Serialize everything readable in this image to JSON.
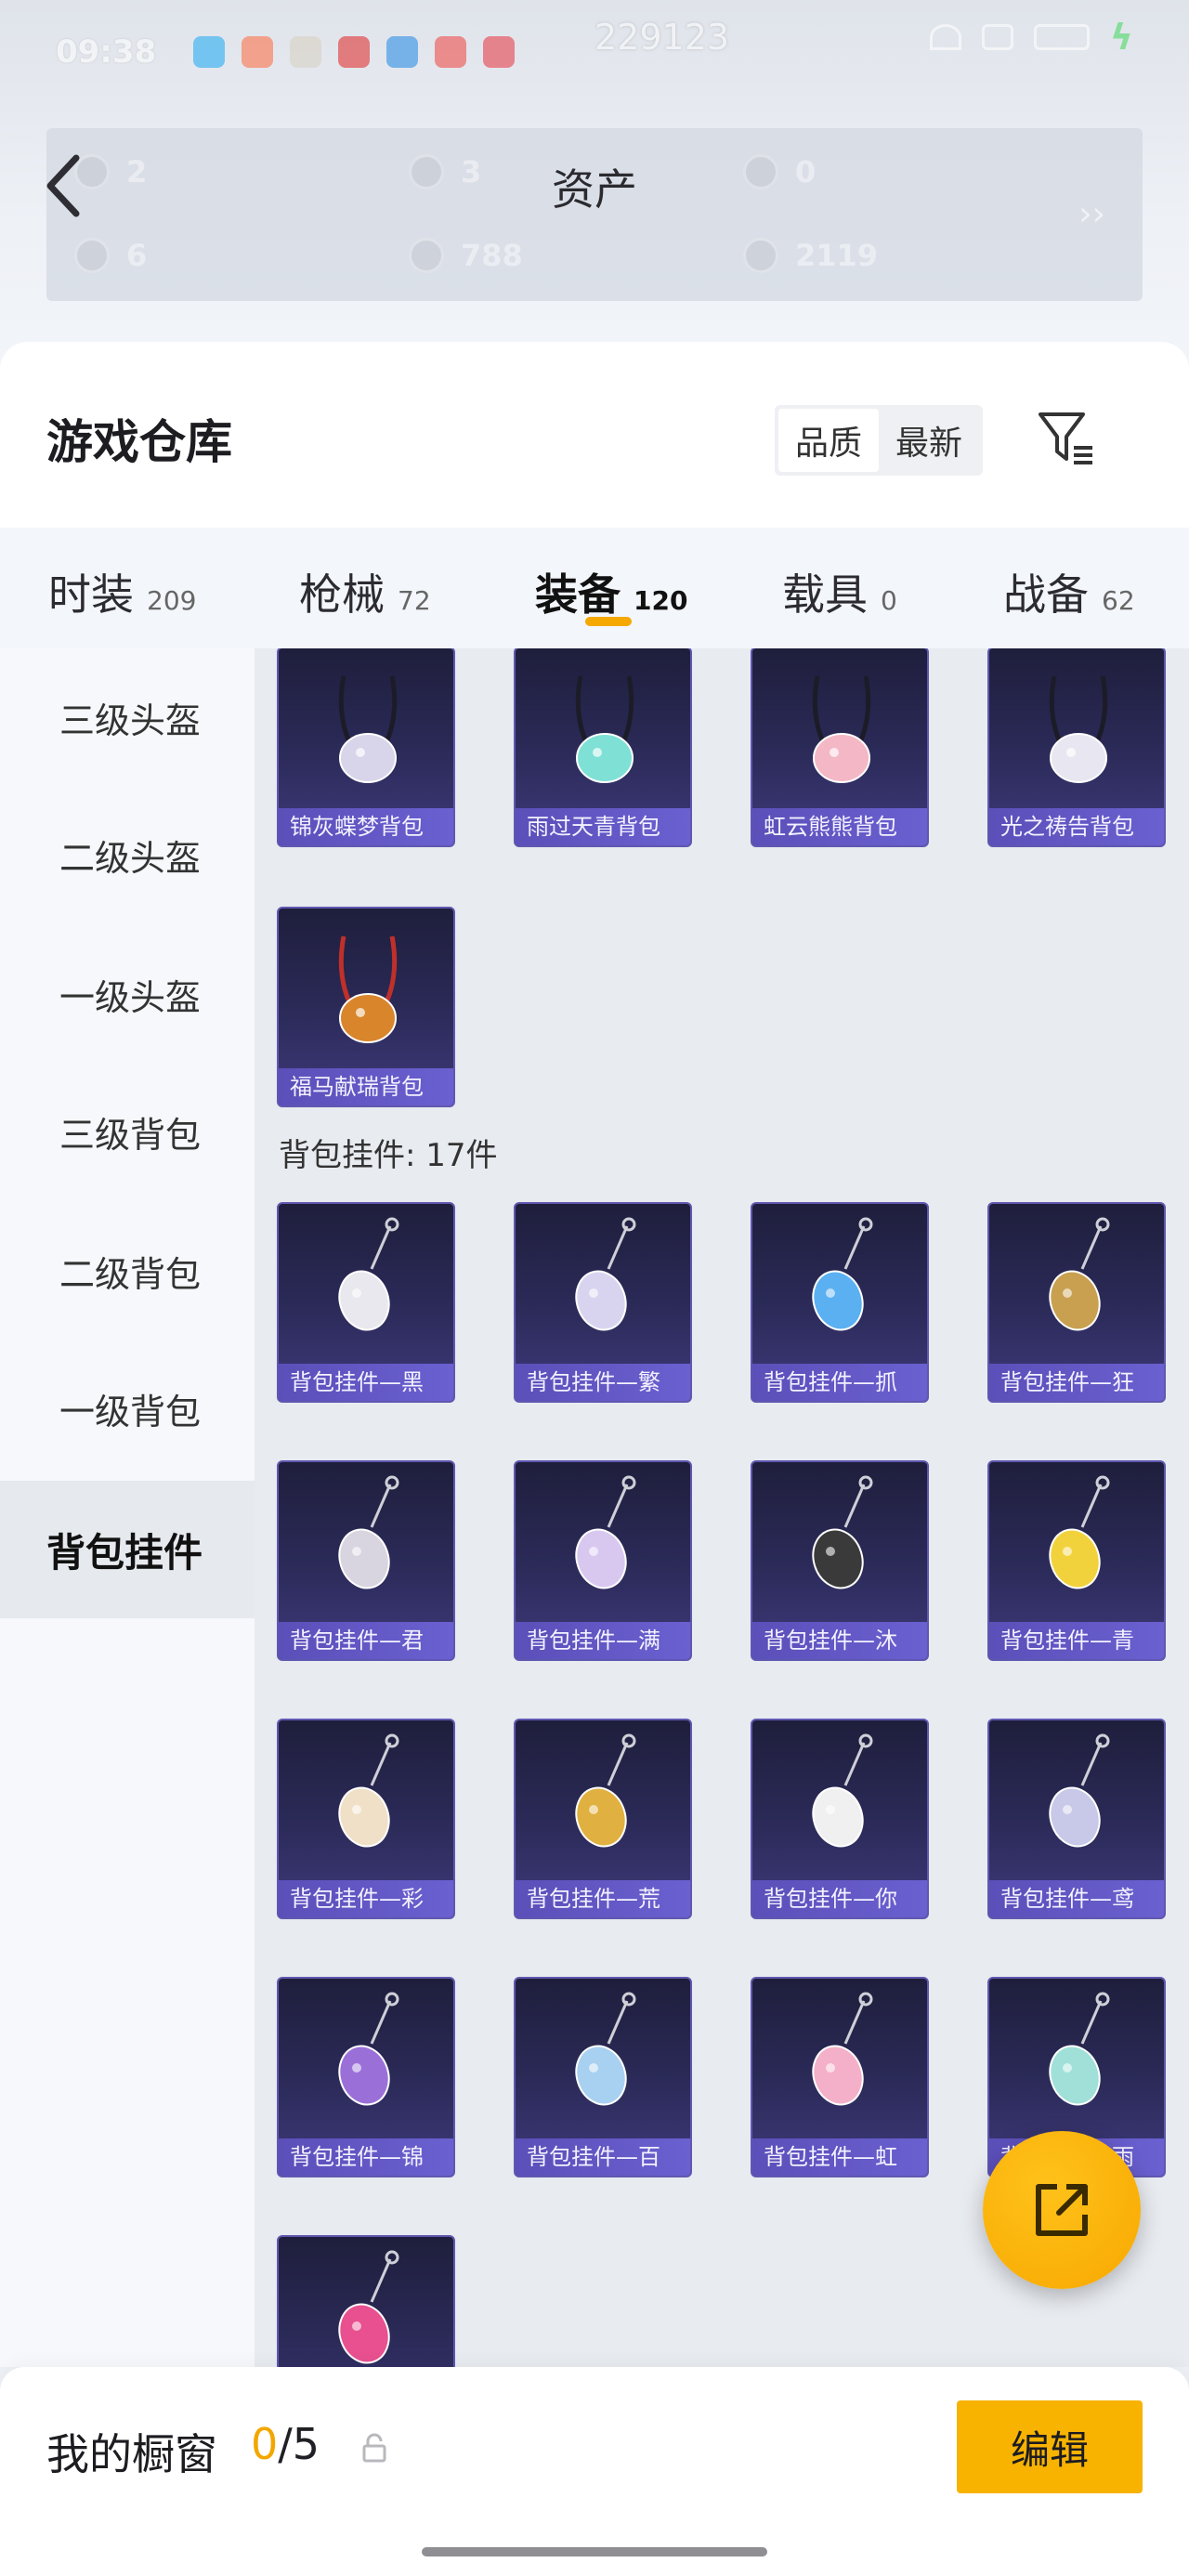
{
  "status_bar": {
    "time": "09:38",
    "center_value": "229123"
  },
  "assets": {
    "title": "资产",
    "items": [
      "2",
      "3",
      "0",
      "6",
      "788",
      "2119"
    ]
  },
  "warehouse": {
    "title": "游戏仓库",
    "sort_options": [
      "品质",
      "最新"
    ]
  },
  "categories": [
    {
      "label": "时装",
      "count": "209"
    },
    {
      "label": "枪械",
      "count": "72"
    },
    {
      "label": "装备",
      "count": "120"
    },
    {
      "label": "载具",
      "count": "0"
    },
    {
      "label": "战备",
      "count": "62"
    }
  ],
  "sidebar": {
    "items": [
      "三级头盔",
      "二级头盔",
      "一级头盔",
      "三级背包",
      "二级背包",
      "一级背包",
      "背包挂件"
    ]
  },
  "backpacks": [
    {
      "name": "锦灰蝶梦背包",
      "icon": "backpack-butterfly"
    },
    {
      "name": "雨过天青背包",
      "icon": "backpack-cyan"
    },
    {
      "name": "虹云熊熊背包",
      "icon": "backpack-pink-bear"
    },
    {
      "name": "光之祷告背包",
      "icon": "backpack-wing"
    },
    {
      "name": "福马献瑞背包",
      "icon": "backpack-horse"
    }
  ],
  "section_label": "背包挂件: 17件",
  "charms": [
    {
      "name": "背包挂件—黑",
      "icon": "charm-bone"
    },
    {
      "name": "背包挂件—繁",
      "icon": "charm-tassel"
    },
    {
      "name": "背包挂件—抓",
      "icon": "charm-anchor"
    },
    {
      "name": "背包挂件—狂",
      "icon": "charm-blade"
    },
    {
      "name": "背包挂件—君",
      "icon": "charm-knife"
    },
    {
      "name": "背包挂件—满",
      "icon": "charm-moon"
    },
    {
      "name": "背包挂件—沐",
      "icon": "charm-cat"
    },
    {
      "name": "背包挂件—青",
      "icon": "charm-pear"
    },
    {
      "name": "背包挂件—彩",
      "icon": "charm-icecream"
    },
    {
      "name": "背包挂件—荒",
      "icon": "charm-sun"
    },
    {
      "name": "背包挂件—你",
      "icon": "charm-penguin"
    },
    {
      "name": "背包挂件—鸢",
      "icon": "charm-feather"
    },
    {
      "name": "背包挂件—锦",
      "icon": "charm-flower"
    },
    {
      "name": "背包挂件—百",
      "icon": "charm-heart"
    },
    {
      "name": "背包挂件—虹",
      "icon": "charm-pig"
    },
    {
      "name": "背包挂件—雨",
      "icon": "charm-jade"
    },
    {
      "name": "",
      "icon": "charm-pink-heart"
    }
  ],
  "showcase": {
    "title": "我的橱窗",
    "current": "0",
    "max": "/5",
    "edit_label": "编辑"
  },
  "colors": {
    "accent": "#f7a800",
    "card_bg": "#2c2b5a",
    "card_label": "#5b4fb9"
  }
}
